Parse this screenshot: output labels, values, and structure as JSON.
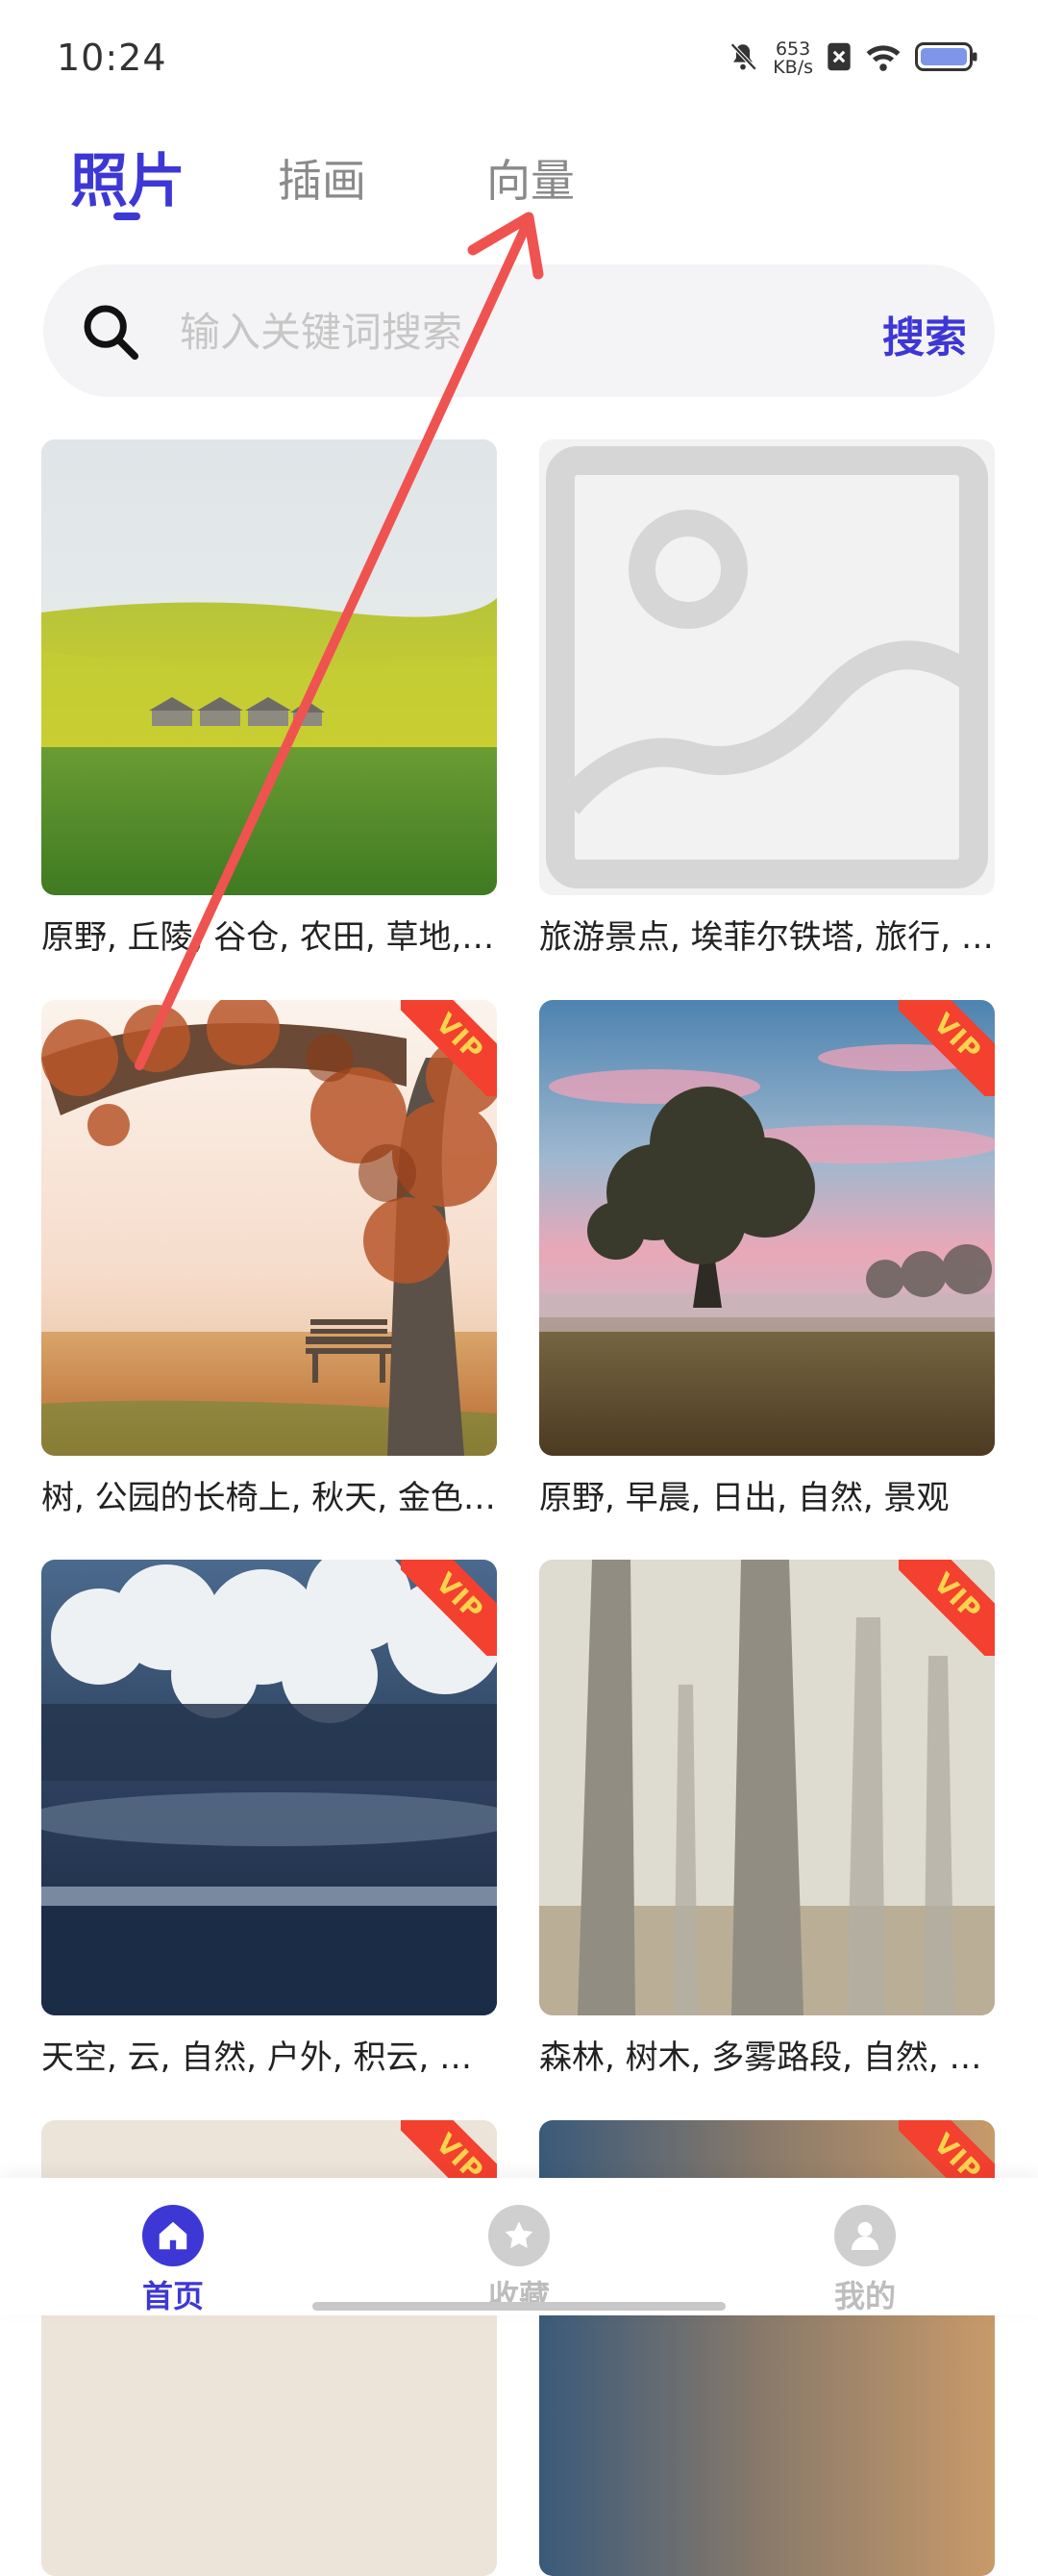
{
  "status_bar": {
    "time": "10:24",
    "net_speed_value": "653",
    "net_speed_unit": "KB/s"
  },
  "tabs": [
    {
      "label": "照片",
      "active": true
    },
    {
      "label": "插画",
      "active": false
    },
    {
      "label": "向量",
      "active": false
    }
  ],
  "search": {
    "placeholder": "输入关键词搜索",
    "button_label": "搜索"
  },
  "cards": [
    {
      "caption": "原野, 丘陵, 谷仓, 农田, 草地, 风景",
      "vip": false
    },
    {
      "caption": "旅游景点, 埃菲尔铁塔, 旅行, 法国",
      "vip": false
    },
    {
      "caption": "树, 公园的长椅上, 秋天, 金色, 落叶",
      "vip": true,
      "badge": "VIP"
    },
    {
      "caption": "原野, 早晨, 日出, 自然, 景观",
      "vip": true,
      "badge": "VIP"
    },
    {
      "caption": "天空, 云, 自然, 户外, 积云, 风景",
      "vip": true,
      "badge": "VIP"
    },
    {
      "caption": "森林, 树木, 多雾路段, 自然, 风景",
      "vip": true,
      "badge": "VIP"
    },
    {
      "caption": "",
      "vip": true,
      "badge": "VIP"
    },
    {
      "caption": "",
      "vip": true,
      "badge": "VIP"
    }
  ],
  "bottom_nav": [
    {
      "label": "首页",
      "icon": "home-icon",
      "active": true
    },
    {
      "label": "收藏",
      "icon": "star-icon",
      "active": false
    },
    {
      "label": "我的",
      "icon": "user-icon",
      "active": false
    }
  ],
  "colors": {
    "accent": "#3d37d6",
    "vip_ribbon": "#f3402f",
    "annotation_arrow": "#ef5350"
  }
}
